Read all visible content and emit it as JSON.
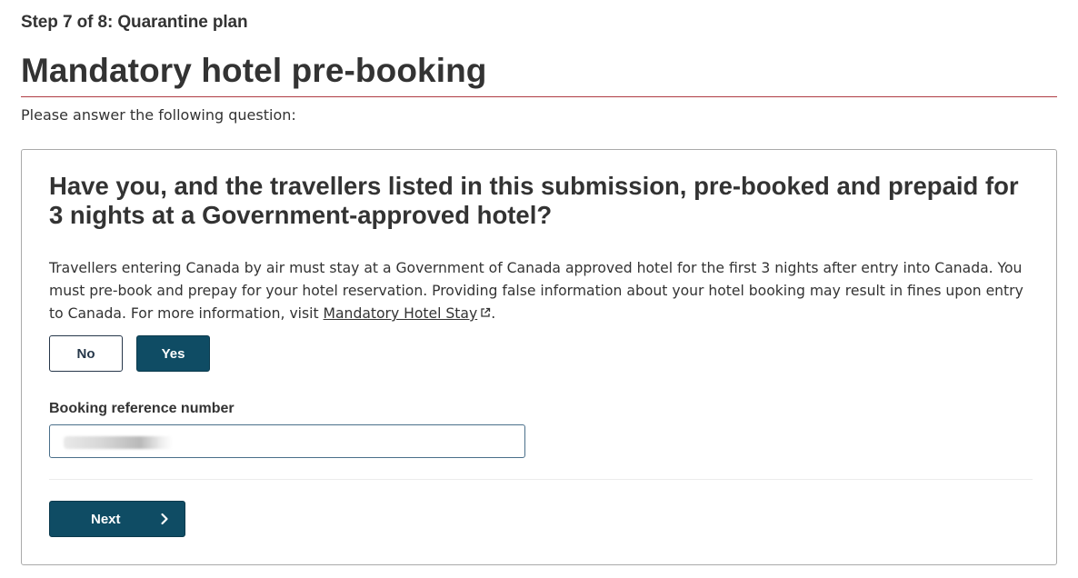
{
  "header": {
    "step": "Step 7 of 8: Quarantine plan",
    "title": "Mandatory hotel pre-booking",
    "intro": "Please answer the following question:"
  },
  "question": {
    "text": "Have you, and the travellers listed in this submission, pre-booked and prepaid for 3 nights at a Government-approved hotel?",
    "description_before_link": "Travellers entering Canada by air must stay at a Government of Canada approved hotel for the first 3 nights after entry into Canada. You must pre-book and prepay for your hotel reservation. Providing false information about your hotel booking may result in fines upon entry to Canada. For more information, visit ",
    "link_text": "Mandatory Hotel Stay",
    "description_after_link": ".",
    "link_icon": "external-link-icon"
  },
  "answers": {
    "no_label": "No",
    "yes_label": "Yes",
    "selected": "Yes"
  },
  "booking": {
    "label": "Booking reference number",
    "value_redacted": true
  },
  "footer": {
    "next_label": "Next",
    "next_icon": "chevron-right-icon"
  },
  "colors": {
    "accent": "#0f4c64",
    "title_rule": "#af3c43",
    "text": "#333333"
  }
}
